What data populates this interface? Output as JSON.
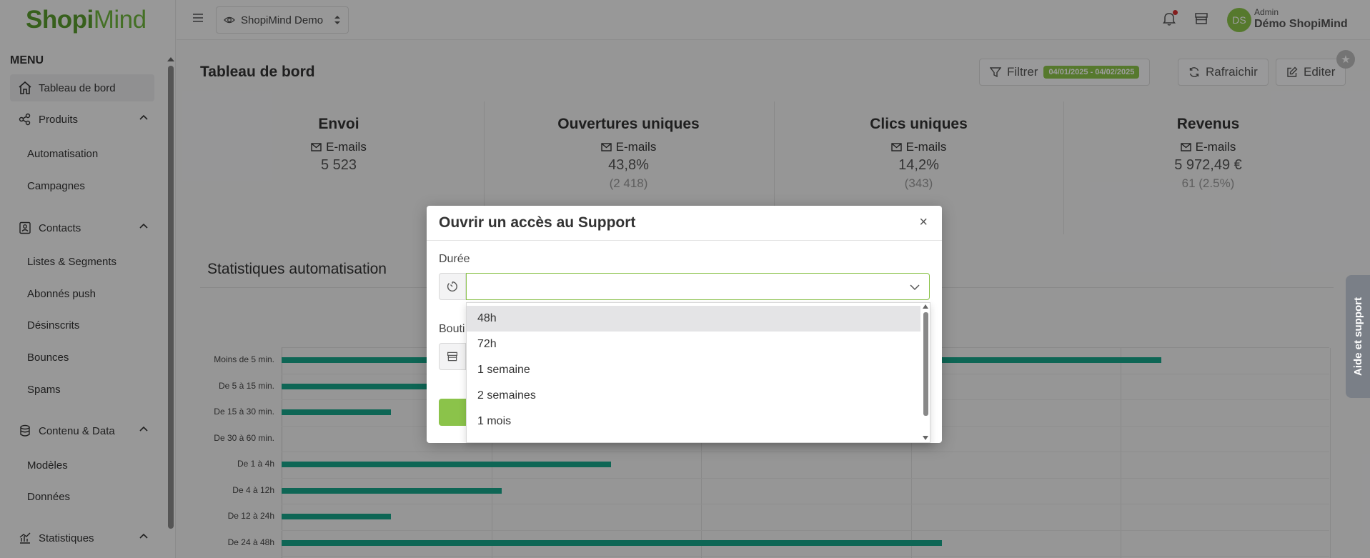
{
  "app": {
    "logo_text": "ShopiMind",
    "menu_title": "MENU"
  },
  "sidebar": {
    "items": [
      {
        "label": "Tableau de bord",
        "icon": "home-icon"
      },
      {
        "label": "Produits",
        "icon": "share-icon"
      },
      {
        "label": "Automatisation"
      },
      {
        "label": "Campagnes"
      },
      {
        "label": "Contacts",
        "icon": "contact-card-icon"
      },
      {
        "label": "Listes & Segments"
      },
      {
        "label": "Abonnés push"
      },
      {
        "label": "Désinscrits"
      },
      {
        "label": "Bounces"
      },
      {
        "label": "Spams"
      },
      {
        "label": "Contenu & Data",
        "icon": "database-icon"
      },
      {
        "label": "Modèles"
      },
      {
        "label": "Données"
      },
      {
        "label": "Statistiques",
        "icon": "chart-icon"
      }
    ]
  },
  "topbar": {
    "shop": "ShopiMind Demo",
    "avatar_initials": "DS",
    "user_role": "Admin",
    "user_name": "Démo ShopiMind"
  },
  "main": {
    "title": "Tableau de bord",
    "filter_label": "Filtrer",
    "date_range": "04/01/2025 - 04/02/2025",
    "refresh_label": "Rafraichir",
    "edit_label": "Editer",
    "stats": [
      {
        "title": "Envoi",
        "sub": "E-mails",
        "value": "5 523",
        "value2": ""
      },
      {
        "title": "Ouvertures uniques",
        "sub": "E-mails",
        "value": "43,8%",
        "value2": "(2 418)"
      },
      {
        "title": "Clics uniques",
        "sub": "E-mails",
        "value": "14,2%",
        "value2": "(343)"
      },
      {
        "title": "Revenus",
        "sub": "E-mails",
        "value": "5 972,49 €",
        "value2": "61 (2.5%)"
      }
    ],
    "section_title": "Statistiques automatisation"
  },
  "chart_data": {
    "type": "bar",
    "orientation": "horizontal",
    "categories": [
      "Moins de 5 min.",
      "De 5 à 15 min.",
      "De 15 à 30 min.",
      "De 30 à 60 min.",
      "De 1 à 4h",
      "De 4 à 12h",
      "De 12 à 24h",
      "De 24 à 48h"
    ],
    "values": [
      1260,
      380,
      157,
      0,
      472,
      315,
      157,
      945
    ],
    "xlim": [
      0,
      1500
    ],
    "grid": true,
    "colors": {
      "bar": "#17a589"
    }
  },
  "side_tab": {
    "label": "Aide et support"
  },
  "modal": {
    "title": "Ouvrir un accès au Support",
    "close": "×",
    "duree_label": "Durée",
    "duree_value": "",
    "boutique_label": "Bouti",
    "options": [
      "48h",
      "72h",
      "1 semaine",
      "2 semaines",
      "1 mois"
    ],
    "highlighted_option": "48h"
  },
  "colors": {
    "accent": "#8bc34a",
    "bar": "#17a589"
  }
}
